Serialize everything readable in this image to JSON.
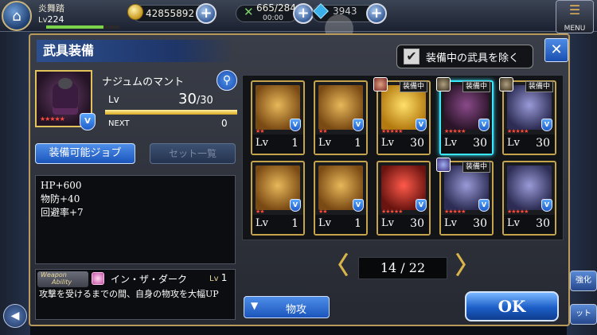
{
  "header": {
    "player_name": "炎舞踏",
    "level_prefix": "Lv",
    "level_value": "224",
    "exp_progress": 0.78,
    "gold": "42855892",
    "stamina": "665/284",
    "stamina_timer": "00:00",
    "gems": "3943",
    "menu_label": "MENU"
  },
  "modal": {
    "title": "武具装備",
    "exclude_equipped_label": "装備中の武具を除く",
    "exclude_equipped_checked": true,
    "close_symbol": "✕"
  },
  "selected_item": {
    "name": "ナジュムのマント",
    "lv_label": "Lv",
    "lv_current": "30",
    "lv_max": "/30",
    "lv_progress": 1.0,
    "next_label": "NEXT",
    "next_value": "0",
    "stars": "★★★★★",
    "shield_symbol": "V"
  },
  "buttons": {
    "equippable_jobs": "装備可能ジョブ",
    "set_list": "セット一覧",
    "sort_label": "物攻",
    "sort_arrow": "▼",
    "ok": "OK",
    "back_arrow": "◀",
    "side_right_top": "強化",
    "side_right_bottom": "ット"
  },
  "stats": [
    "HP+600",
    "物防+40",
    "回避率+7"
  ],
  "weapon_ability": {
    "tag_line1": "Weapon",
    "tag_line2": "Ability",
    "name": "イン・ザ・ダーク",
    "lv_label": "Lv",
    "lv_value": "1",
    "description": "攻撃を受けるまでの間、自身の物攻を大幅UP"
  },
  "grid": {
    "items": [
      {
        "art": "gold-armor",
        "lv_label": "Lv",
        "lv": "1",
        "stars": "★★",
        "equipped": false,
        "equipped_label": "",
        "selected": false
      },
      {
        "art": "gold-armor",
        "lv_label": "Lv",
        "lv": "1",
        "stars": "★★",
        "equipped": false,
        "equipped_label": "",
        "selected": false
      },
      {
        "art": "gold-plate",
        "lv_label": "Lv",
        "lv": "30",
        "stars": "★★★★★",
        "equipped": true,
        "equipped_label": "装備中",
        "equipper": "red",
        "selected": false
      },
      {
        "art": "dark-cloak",
        "lv_label": "Lv",
        "lv": "30",
        "stars": "★★★★★",
        "equipped": true,
        "equipped_label": "装備中",
        "equipper": "dark",
        "selected": true
      },
      {
        "art": "purple-armor",
        "lv_label": "Lv",
        "lv": "30",
        "stars": "★★★★★",
        "equipped": true,
        "equipped_label": "装備中",
        "equipper": "dark",
        "selected": false
      },
      {
        "art": "gold-armor",
        "lv_label": "Lv",
        "lv": "1",
        "stars": "★★",
        "equipped": false,
        "equipped_label": "",
        "selected": false
      },
      {
        "art": "gold-armor",
        "lv_label": "Lv",
        "lv": "1",
        "stars": "★★",
        "equipped": false,
        "equipped_label": "",
        "selected": false
      },
      {
        "art": "red-shield",
        "lv_label": "Lv",
        "lv": "30",
        "stars": "★★★★★",
        "equipped": false,
        "equipped_label": "",
        "selected": false
      },
      {
        "art": "purple-armor",
        "lv_label": "Lv",
        "lv": "30",
        "stars": "★★★★★",
        "equipped": true,
        "equipped_label": "装備中",
        "equipper": "blue",
        "selected": false
      },
      {
        "art": "purple-armor",
        "lv_label": "Lv",
        "lv": "30",
        "stars": "★★★★★",
        "equipped": false,
        "equipped_label": "",
        "selected": false
      }
    ]
  },
  "pager": {
    "current": "14",
    "separator": " / ",
    "total": "22",
    "prev_symbol": "〈",
    "next_symbol": "〉"
  },
  "colors": {
    "accent_blue": "#1b55bc",
    "frame_gold": "#c6a44c",
    "selected_cyan": "#3be8ff",
    "star_red": "#ff4a3a"
  }
}
